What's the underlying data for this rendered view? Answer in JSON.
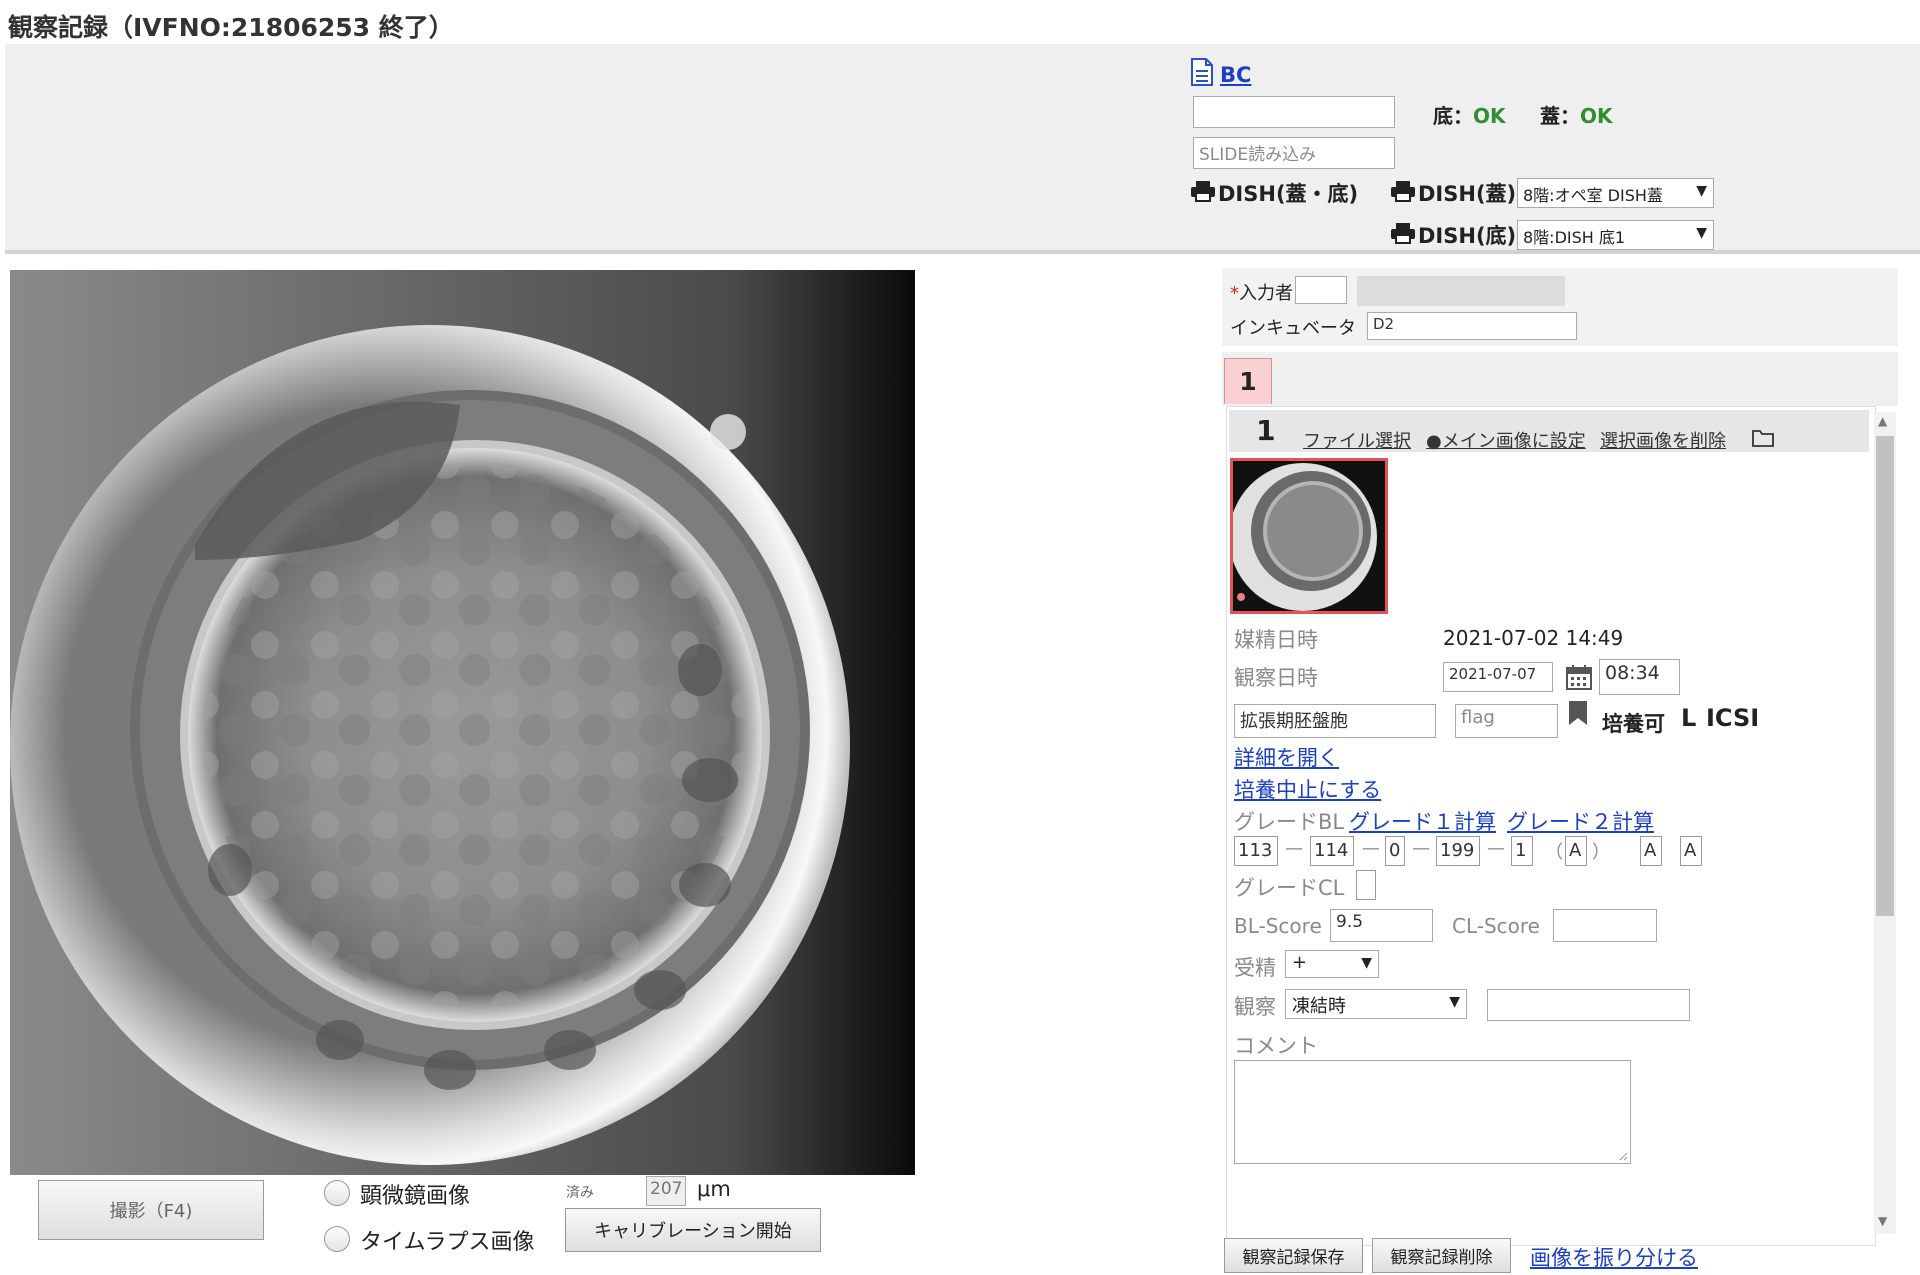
{
  "window": {
    "title": "観察記録（IVFNO:21806253 終了）"
  },
  "barcode": {
    "link_label": "BC",
    "bc_input_value": "",
    "slide_placeholder": "SLIDE読み込み",
    "bottom_label": "底：",
    "bottom_status": "OK",
    "lid_label": "蓋：",
    "lid_status": "OK"
  },
  "print": {
    "dish_both": "DISH(蓋・底)",
    "dish_lid": "DISH(蓋)",
    "dish_lid_select": "8階:オペ室 DISH蓋",
    "dish_bottom": "DISH(底)",
    "dish_bottom_select": "8階:DISH 底1"
  },
  "capture": {
    "shoot_button": "撮影（F4)",
    "radio_microscope": "顕微鏡画像",
    "radio_timelapse": "タイムラプス画像",
    "measured_label": "済み",
    "measure_value": "207",
    "measure_unit": "μm",
    "calibration_button": "キャリブレーション開始"
  },
  "entry": {
    "operator_label": "入力者",
    "operator_value": "",
    "incubator_label": "インキュベータ",
    "incubator_value": "D2"
  },
  "tabs": {
    "active": "1"
  },
  "record": {
    "index": "1",
    "file_select": "ファイル選択",
    "set_main": "●メイン画像に設定",
    "delete_selected": "選択画像を削除",
    "insemination_label": "媒精日時",
    "insemination_value": "2021-07-02 14:49",
    "observation_label": "観察日時",
    "observation_date": "2021-07-07",
    "observation_time": "08:34",
    "stage_value": "拡張期胚盤胞",
    "flag_placeholder": "flag",
    "culture_status": "培養可",
    "side_label": "L",
    "method_label": "ICSI",
    "open_details": "詳細を開く",
    "stop_culture": "培養中止にする",
    "grade_bl_label": "グレードBL",
    "grade1_calc": "グレード１計算",
    "grade2_calc": "グレード２計算",
    "grade_values": [
      "113",
      "114",
      "0",
      "199",
      "1"
    ],
    "grade_paren_open": "（",
    "grade_paren_close": "）",
    "grade_letters": [
      "A",
      "A",
      "A"
    ],
    "grade_cl_label": "グレードCL",
    "bl_score_label": "BL-Score",
    "bl_score_value": "9.5",
    "cl_score_label": "CL-Score",
    "cl_score_value": "",
    "fertilization_label": "受精",
    "fertilization_value": "+",
    "observation_type_label": "観察",
    "observation_type_value": "凍結時",
    "comment_label": "コメント"
  },
  "footer": {
    "save": "観察記録保存",
    "delete": "観察記録削除",
    "distribute": "画像を振り分ける"
  }
}
